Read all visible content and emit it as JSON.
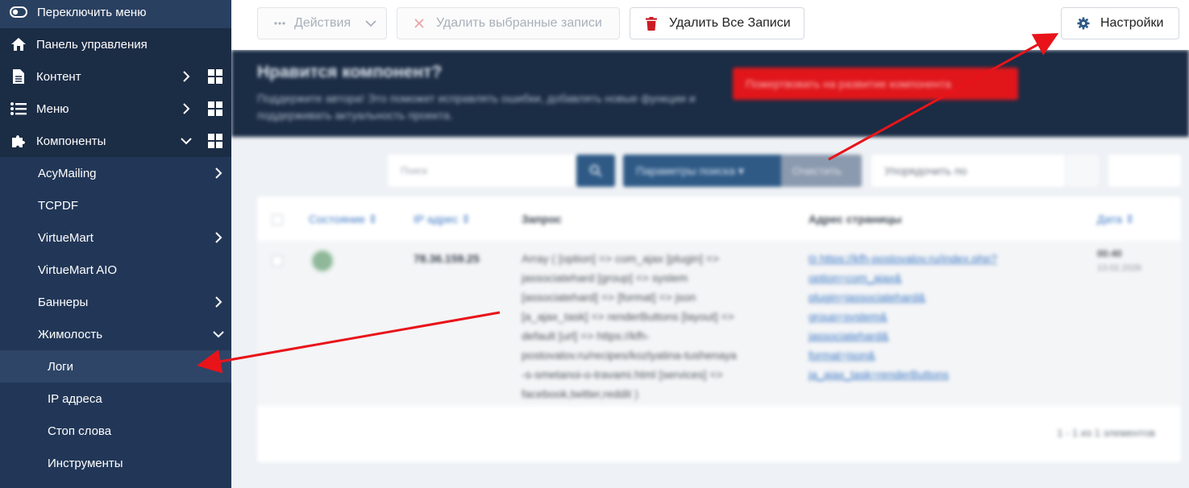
{
  "sidebar": {
    "toggle_label": "Переключить меню",
    "items": [
      {
        "label": "Панель управления"
      },
      {
        "label": "Контент"
      },
      {
        "label": "Меню"
      },
      {
        "label": "Компоненты"
      }
    ],
    "components": [
      {
        "label": "AcyMailing"
      },
      {
        "label": "TCPDF"
      },
      {
        "label": "VirtueMart"
      },
      {
        "label": "VirtueMart AIO"
      },
      {
        "label": "Баннеры"
      },
      {
        "label": "Жимолость"
      }
    ],
    "zhimolost_sub": [
      {
        "label": "Логи"
      },
      {
        "label": "IP адреса"
      },
      {
        "label": "Стоп слова"
      },
      {
        "label": "Инструменты"
      }
    ]
  },
  "toolbar": {
    "actions_label": "Действия",
    "delete_selected_label": "Удалить выбранные записи",
    "delete_all_label": "Удалить Все Записи",
    "settings_label": "Настройки"
  },
  "banner": {
    "title": "Нравится компонент?",
    "description": "Поддержите автора! Это поможет исправлять ошибки, добавлять новые функции и поддерживать актуальность проекта.",
    "donate_label": "Пожертвовать на развитие компонента"
  },
  "filters": {
    "search_placeholder": "Поиск",
    "params_label": "Параметры поиска ▾",
    "clear_label": "Очистить",
    "order_label": "Упорядочить по"
  },
  "table": {
    "headers": {
      "status": "Состояние ⇕",
      "ip": "IP адрес ⇕",
      "request": "Запрос",
      "page": "Адрес страницы",
      "date": "Дата ⇕"
    },
    "row": {
      "ip": "78.36.159.25",
      "request_lines": [
        "Array ( [option] => com_ajax [plugin] =>",
        "jassociatehard [group] => system",
        "[associatehard] => [format] => json",
        "[a_ajax_task] => renderButtons [layout] =>",
        "default [url] => https://kfh-",
        "postovalov.ru/recipes/kozlyatina-tushenaya",
        "-s-smetanoi-o-travami.html [services] =>",
        "facebook,twitter,reddit )"
      ],
      "page_lines": [
        "⧉ https://kfh-postovalov.ru/index.php?",
        "option=com_ajax&",
        "plugin=jassociatehard&",
        "group=system&",
        "jassociatehard&",
        "format=json&",
        "ja_ajax_task=renderButtons"
      ],
      "time": "00:40",
      "date": "13.02.2026"
    },
    "footer": "1 - 1 из 1 элементов"
  },
  "colors": {
    "sidebar_bg": "#1b2c45",
    "accent_red": "#e0161b",
    "link_blue": "#3b78c4",
    "arrow_red": "#e8141a"
  }
}
